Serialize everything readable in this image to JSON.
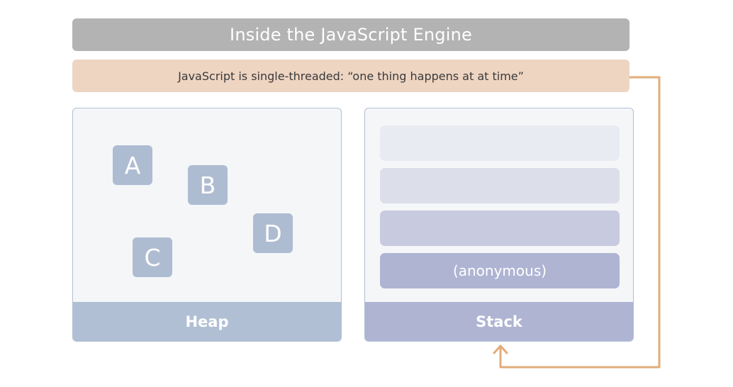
{
  "title": "Inside the JavaScript Engine",
  "subtitle": "JavaScript is single-threaded: “one thing happens at at time”",
  "heap": {
    "label": "Heap",
    "items": [
      "A",
      "B",
      "C",
      "D"
    ]
  },
  "stack": {
    "label": "Stack",
    "frames": [
      "",
      "",
      "",
      "(anonymous)"
    ]
  },
  "colors": {
    "title_bg": "#b3b3b3",
    "subtitle_bg": "#eed5c2",
    "heap_accent": "#b0bfd4",
    "heap_item": "#aebcd2",
    "stack_accent": "#afb4d3",
    "stack_frames": [
      "#e9ebf2",
      "#dcdfea",
      "#c8cbdf",
      "#afb4d3"
    ],
    "arrow": "#e2ac78"
  }
}
